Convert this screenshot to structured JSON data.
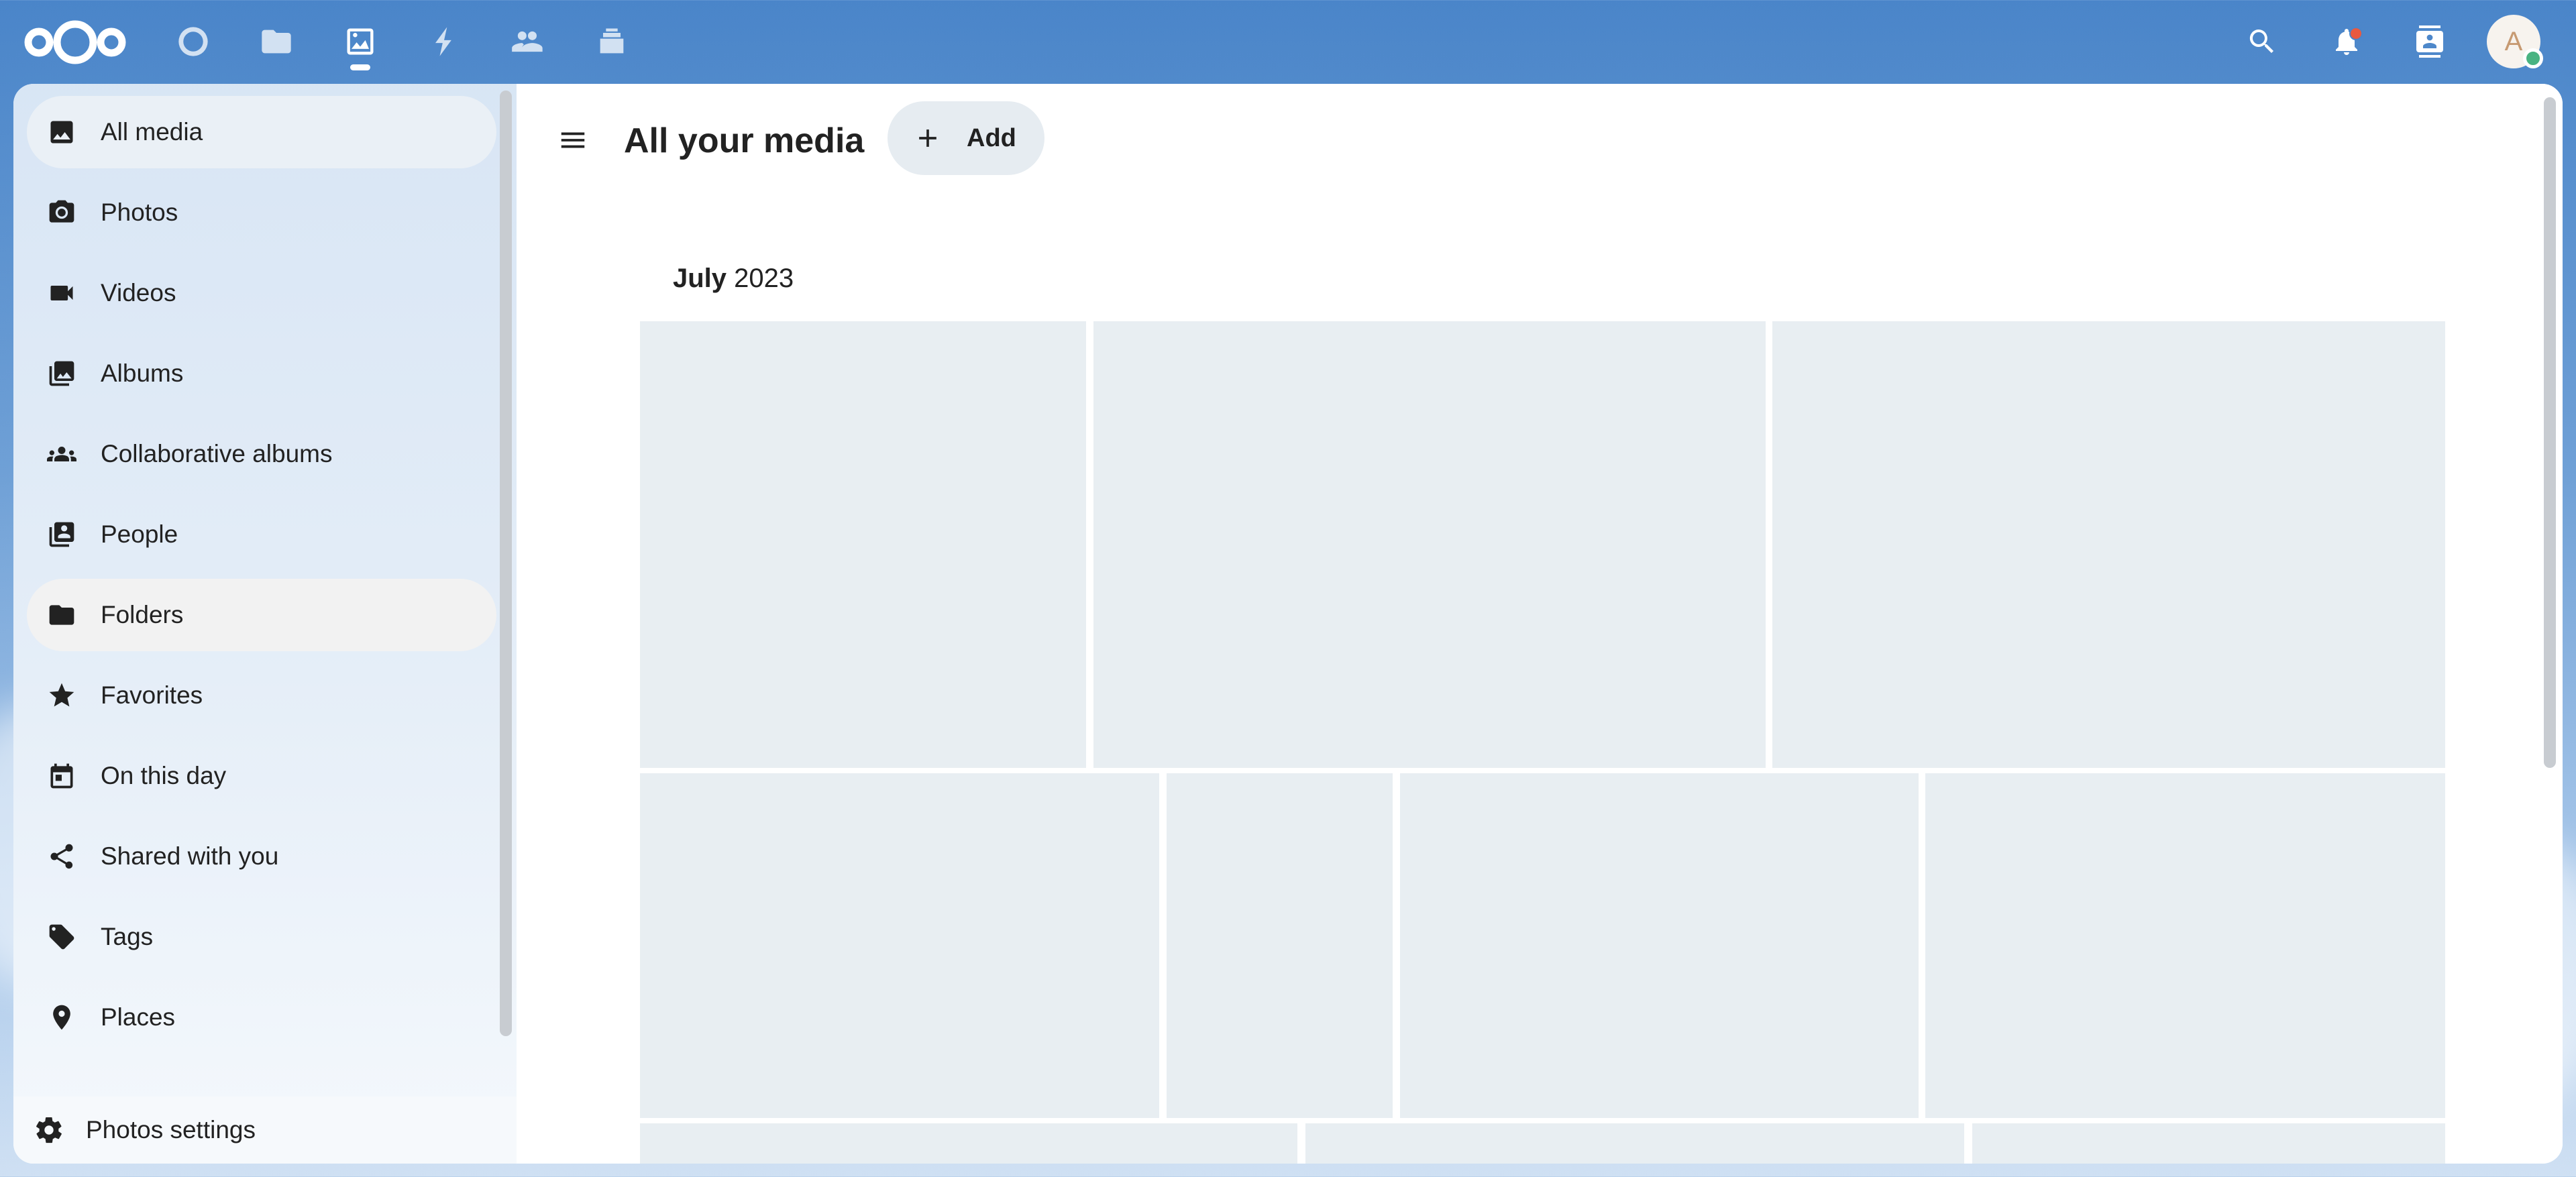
{
  "header": {
    "apps": [
      {
        "name": "dashboard-icon",
        "label": "Dashboard"
      },
      {
        "name": "files-icon",
        "label": "Files"
      },
      {
        "name": "photos-icon",
        "label": "Photos",
        "active": true
      },
      {
        "name": "activity-icon",
        "label": "Activity"
      },
      {
        "name": "contacts-icon",
        "label": "Contacts"
      },
      {
        "name": "deck-icon",
        "label": "Deck"
      }
    ],
    "avatar_initial": "A",
    "accent_color": "#4a85c9"
  },
  "sidebar": {
    "items": [
      {
        "label": "All media",
        "icon": "image-icon",
        "active": true
      },
      {
        "label": "Photos",
        "icon": "camera-icon"
      },
      {
        "label": "Videos",
        "icon": "video-icon"
      },
      {
        "label": "Albums",
        "icon": "albums-icon"
      },
      {
        "label": "Collaborative albums",
        "icon": "group-icon"
      },
      {
        "label": "People",
        "icon": "people-icon"
      },
      {
        "label": "Folders",
        "icon": "folder-icon"
      },
      {
        "label": "Favorites",
        "icon": "star-icon"
      },
      {
        "label": "On this day",
        "icon": "calendar-icon"
      },
      {
        "label": "Shared with you",
        "icon": "share-icon"
      },
      {
        "label": "Tags",
        "icon": "tag-icon"
      },
      {
        "label": "Places",
        "icon": "map-marker-icon"
      }
    ],
    "settings_label": "Photos settings"
  },
  "main": {
    "title": "All your media",
    "add_label": "Add",
    "month": "July",
    "year": "2023"
  }
}
